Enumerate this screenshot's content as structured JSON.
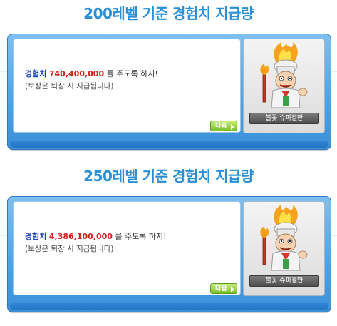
{
  "sections": [
    {
      "heading": "200레벨 기준 경험치 지급량",
      "exp_label": "경험치",
      "exp_value": "740,400,000",
      "line1_suffix": " 를 주도록 하지!",
      "line2": "(보상은 퇴장 시 지급됩니다)",
      "next_label": "다음",
      "npc_name": "불꽃 슈피겔만"
    },
    {
      "heading": "250레벨 기준 경험치 지급량",
      "exp_label": "경험치",
      "exp_value": "4,386,100,000",
      "line1_suffix": " 를 주도록 하지!",
      "line2": "(보상은 퇴장 시 지급됩니다)",
      "next_label": "다음",
      "npc_name": "불꽃 슈피겔만"
    }
  ],
  "colors": {
    "heading": "#2b8fd6",
    "exp_label": "#1d47b8",
    "exp_value": "#d21f1f",
    "dialog_frame": "#4aa3e6",
    "next_button": "#79c12b"
  },
  "icons": {
    "npc": "spiegelmann-flame-npc",
    "next_arrow": "triangle-right"
  }
}
